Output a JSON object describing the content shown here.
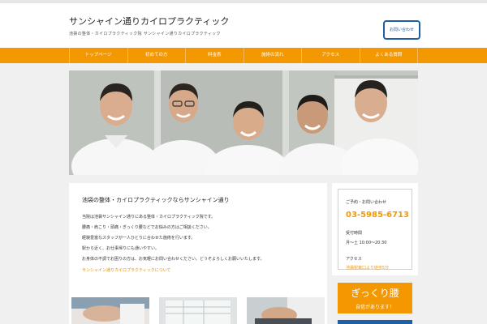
{
  "header": {
    "site_title": "サンシャイン通りカイロプラクティック",
    "site_description": "池袋の整体・カイロプラクティック院 サンシャイン通りカイロプラクティック",
    "cta_label": "お問い合わせ"
  },
  "nav": {
    "items": [
      {
        "label": "トップページ"
      },
      {
        "label": "初めての方"
      },
      {
        "label": "料金表"
      },
      {
        "label": "施術の流れ"
      },
      {
        "label": "アクセス"
      },
      {
        "label": "よくある質問"
      }
    ]
  },
  "hero": {
    "image_alt": "スタッフ集合写真"
  },
  "main": {
    "heading": "池袋の整体・カイロプラクティックならサンシャイン通り",
    "paragraphs": [
      "当院は池袋サンシャイン通りにある整体・カイロプラクティック院です。",
      "腰痛・肩こり・頭痛・ぎっくり腰などでお悩みの方はご相談ください。",
      "経験豊富なスタッフが一人ひとりに合わせた施術を行います。",
      "駅から近く、お仕事帰りにも通いやすい。",
      "お身体の不調でお困りの方は、お気軽にお問い合わせください。どうぞよろしくお願いいたします。"
    ],
    "more_link": "サンシャイン通りカイロプラクティックについて"
  },
  "sidebar": {
    "phone_label": "ご予約・お問い合わせ",
    "phone": "03-5985-6713",
    "hours_label": "受付時間",
    "hours_value": "月〜土 10:00〜20:30",
    "access_label": "アクセス",
    "access_link": "池袋駅東口より徒歩5分",
    "banner_title": "ぎっくり腰",
    "banner_subtitle": "自信があります！"
  },
  "colors": {
    "accent": "#f39800",
    "brand_blue": "#1f5fa8"
  }
}
